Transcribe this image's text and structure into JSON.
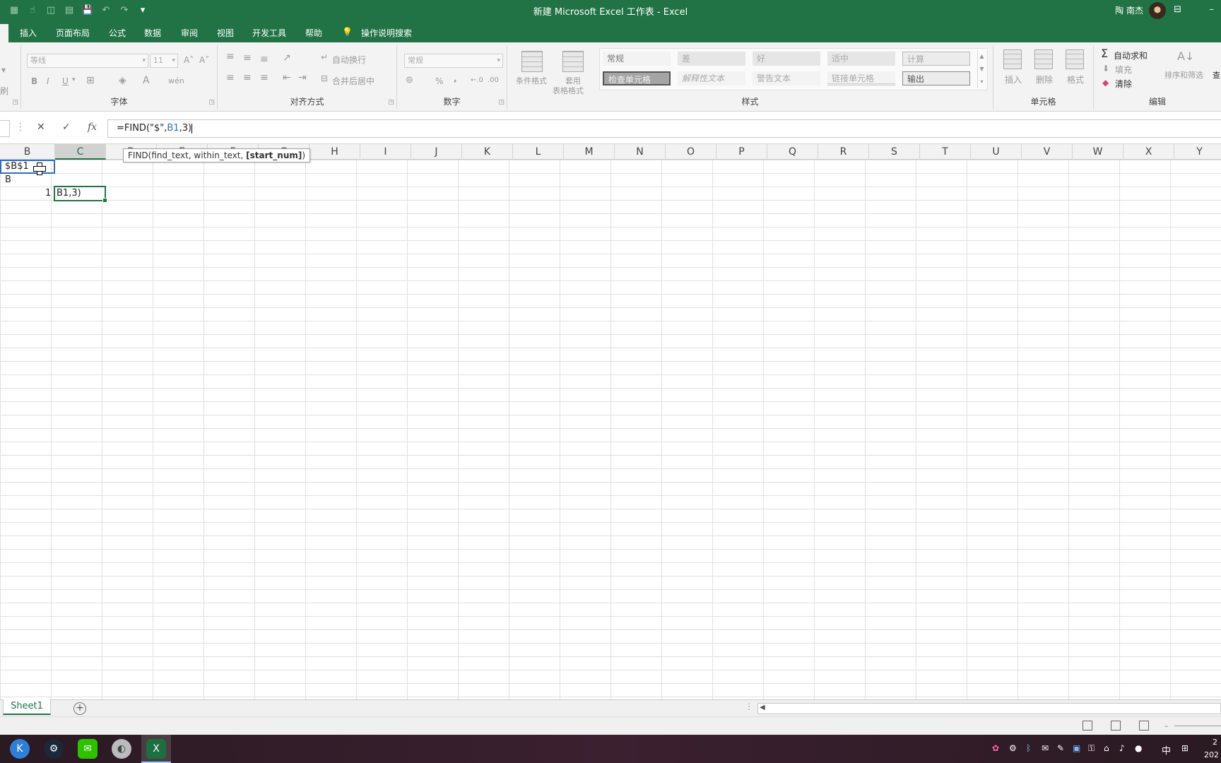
{
  "window": {
    "title": "新建 Microsoft Excel 工作表  -  Excel",
    "user_name": "陶 南杰",
    "ribbon_display_icon": "ribbon-display-icon",
    "minimize_label": "–"
  },
  "qat": [
    "autosave-icon",
    "touch-icon",
    "view-icon",
    "table-icon",
    "save-icon",
    "undo-icon",
    "redo-icon",
    "customize-icon"
  ],
  "tabs": [
    {
      "label": "插入"
    },
    {
      "label": "页面布局"
    },
    {
      "label": "公式"
    },
    {
      "label": "数据"
    },
    {
      "label": "审阅"
    },
    {
      "label": "视图"
    },
    {
      "label": "开发工具"
    },
    {
      "label": "帮助"
    },
    {
      "label": "操作说明搜索"
    }
  ],
  "ribbon": {
    "font": {
      "name": "等线",
      "size": "11",
      "bold": "B",
      "italic": "I",
      "underline": "U",
      "font_color": "A",
      "phonetic": "wén",
      "grow": "A˄",
      "shrink": "A˅",
      "label": "字体"
    },
    "alignment": {
      "wrap": "自动换行",
      "merge": "合并后居中",
      "label": "对齐方式"
    },
    "number": {
      "format": "常规",
      "percent": "%",
      "comma": ",",
      "inc_dec": "←.0",
      "dec_dec": ".00",
      "label": "数字"
    },
    "styles": {
      "conditional": "条件格式",
      "table_format_1": "套用",
      "table_format_2": "表格格式",
      "cells": [
        {
          "label": "常规",
          "bg": "#f3f3f3",
          "color": "#777"
        },
        {
          "label": "差",
          "bg": "#e6e6e6",
          "color": "#aaa"
        },
        {
          "label": "好",
          "bg": "#e6e6e6",
          "color": "#aaa"
        },
        {
          "label": "适中",
          "bg": "#e6e6e6",
          "color": "#aaa"
        },
        {
          "label": "计算",
          "bg": "#ececec",
          "color": "#aaa"
        },
        {
          "label": "检查单元格",
          "bg": "#a5a5a5",
          "color": "#f2f2f2"
        },
        {
          "label": "解释性文本",
          "bg": "#f3f3f3",
          "color": "#aaa"
        },
        {
          "label": "警告文本",
          "bg": "#f3f3f3",
          "color": "#aaa"
        },
        {
          "label": "链接单元格",
          "bg": "#f3f3f3",
          "color": "#aaa"
        },
        {
          "label": "输出",
          "bg": "#ececec",
          "color": "#555"
        }
      ],
      "label": "样式"
    },
    "cells_group": {
      "insert": "插入",
      "delete": "删除",
      "format": "格式",
      "label": "单元格"
    },
    "editing": {
      "autosum": "自动求和",
      "fill": "填充",
      "clear": "清除",
      "sort_filter": "排序和筛选",
      "find": "查",
      "label": "编辑"
    },
    "clipboard_fragment": "刷"
  },
  "formula_bar": {
    "cancel": "✕",
    "enter": "✓",
    "fx": "fx",
    "formula_prefix": "=FIND(\"$\",",
    "formula_ref": "B1",
    "formula_suffix": ",3)"
  },
  "tooltip": {
    "fn_text": "FIND(find_text, within_text, ",
    "current_arg": "[start_num]",
    "close": ")"
  },
  "columns": [
    "B",
    "C",
    "D",
    "E",
    "F",
    "G",
    "H",
    "I",
    "J",
    "K",
    "L",
    "M",
    "N",
    "O",
    "P",
    "Q",
    "R",
    "S",
    "T",
    "U",
    "V",
    "W",
    "X",
    "Y"
  ],
  "cells": {
    "b1": "$B$1",
    "b2": "B",
    "b3": "1",
    "c3": "B1,3)"
  },
  "sheets": [
    {
      "name": "Sheet1"
    }
  ],
  "add_sheet": "+",
  "taskbar": {
    "apps": [
      "kde-icon",
      "steam-icon",
      "wechat-icon",
      "disk-icon",
      "excel-icon"
    ],
    "ime": "中",
    "clock_fragment_1": "2",
    "clock_fragment_2": "202"
  }
}
